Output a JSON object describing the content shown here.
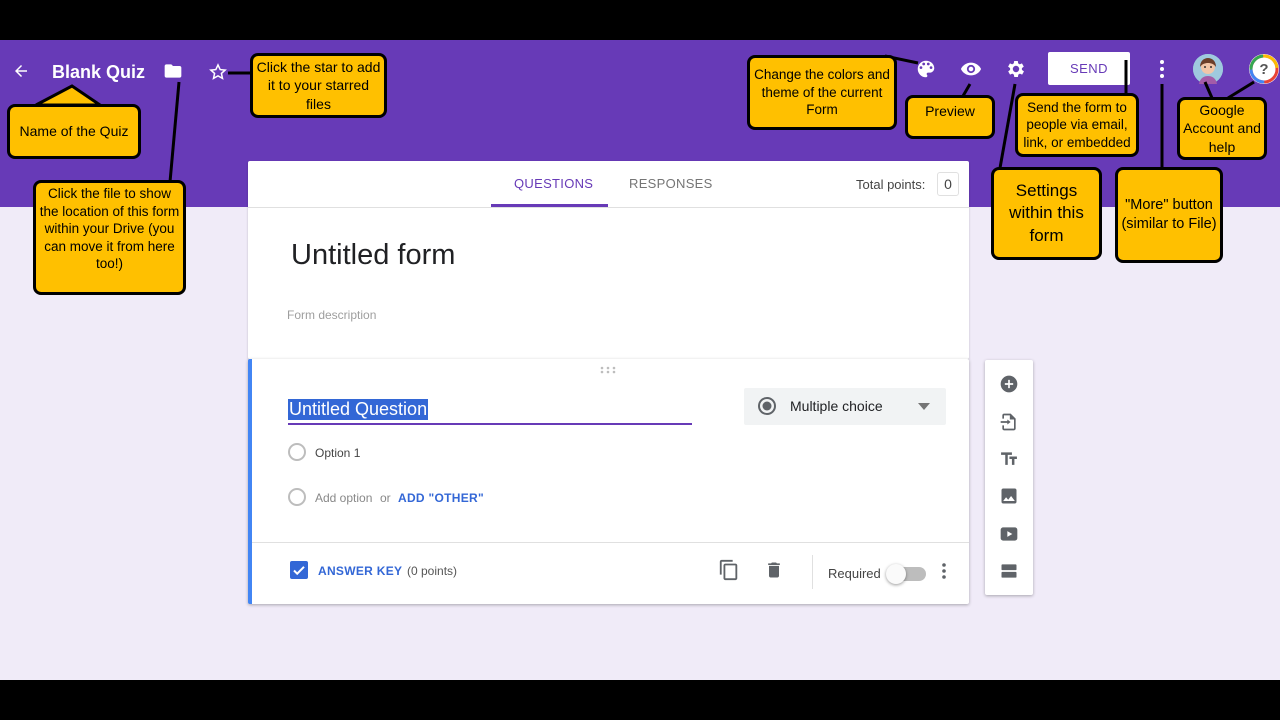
{
  "header": {
    "quiz_title": "Blank Quiz",
    "send_label": "SEND"
  },
  "tabs": {
    "questions": "QUESTIONS",
    "responses": "RESPONSES",
    "total_points_label": "Total points:",
    "total_points_value": "0"
  },
  "form": {
    "title": "Untitled form",
    "description_placeholder": "Form description"
  },
  "question": {
    "title": "Untitled Question",
    "type": "Multiple choice",
    "option1": "Option 1",
    "add_option": "Add option",
    "or": "or",
    "add_other": "ADD \"OTHER\"",
    "answer_key": "ANSWER KEY",
    "points": "(0 points)",
    "required": "Required"
  },
  "callouts": {
    "name_of_quiz": "Name of the Quiz",
    "file_location": "Click the file to show the location of this form within your Drive (you can move it from here too!)",
    "star": "Click the star to add it to your starred files",
    "colors": "Change the colors and theme of the current Form",
    "preview": "Preview",
    "send": "Send the form to people via email, link, or embedded",
    "google_account": "Google Account and help",
    "settings": "Settings within this form",
    "more": "\"More\" button (similar to File)"
  },
  "colors": {
    "header": "#673ab7",
    "background": "#f0ebf8",
    "callout": "#ffc000",
    "accent_blue": "#3367d6"
  }
}
